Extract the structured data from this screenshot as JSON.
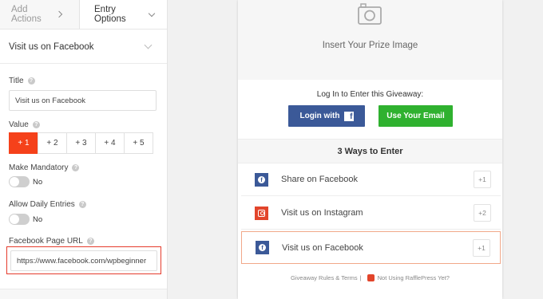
{
  "tabs": {
    "add_actions": "Add Actions",
    "entry_options": "Entry Options"
  },
  "section": {
    "title": "Visit us on Facebook"
  },
  "form": {
    "title_label": "Title",
    "title_value": "Visit us on Facebook",
    "value_label": "Value",
    "value_options": [
      "+ 1",
      "+ 2",
      "+ 3",
      "+ 4",
      "+ 5"
    ],
    "selected_value": "+ 1",
    "mandatory_label": "Make Mandatory",
    "mandatory_state": "No",
    "daily_label": "Allow Daily Entries",
    "daily_state": "No",
    "url_label": "Facebook Page URL",
    "url_value": "https://www.facebook.com/wpbeginner"
  },
  "preview": {
    "prize_text": "Insert Your Prize Image",
    "login_prompt": "Log In to Enter this Giveaway:",
    "login_facebook": "Login with",
    "use_email": "Use Your Email",
    "ways_heading": "3 Ways to Enter",
    "entries": [
      {
        "label": "Share on Facebook",
        "points": "+1",
        "icon": "facebook-icon"
      },
      {
        "label": "Visit us on Instagram",
        "points": "+2",
        "icon": "instagram-icon"
      },
      {
        "label": "Visit us on Facebook",
        "points": "+1",
        "icon": "facebook-icon"
      }
    ],
    "footer_rules": "Giveaway Rules & Terms",
    "footer_sep": "|",
    "footer_promo": "Not Using RafflePress Yet?"
  },
  "colors": {
    "facebook": "#3b5998",
    "email_green": "#2fb12f",
    "accent_red": "#f5411a",
    "instagram": "#e2452b",
    "highlight_box": "#e53b2c"
  }
}
